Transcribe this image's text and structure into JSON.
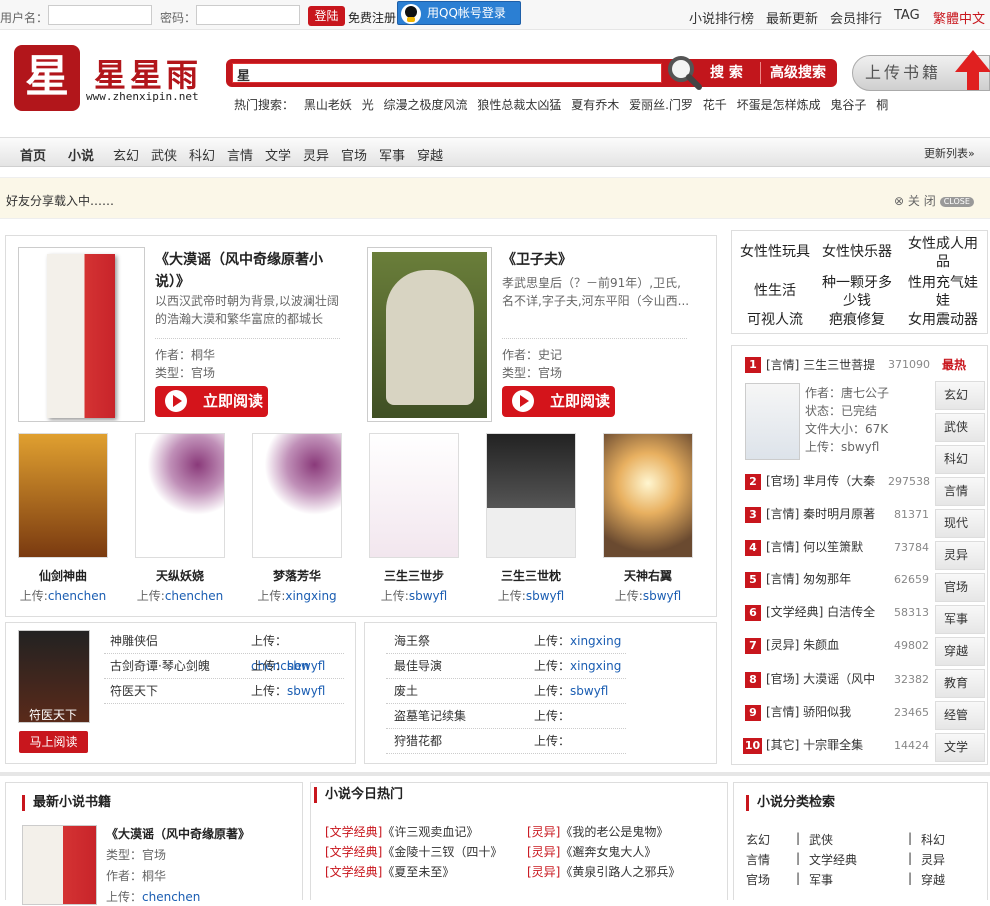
{
  "topbar": {
    "username_label": "用户名：",
    "password_label": "密码：",
    "login_btn": "登陆",
    "register": "免费注册",
    "qq_login": "用QQ帐号登录",
    "links": [
      "小说排行榜",
      "最新更新",
      "会员排行",
      "TAG"
    ],
    "lang": "繁體中文"
  },
  "logo": {
    "char": "星",
    "title": "星星雨",
    "url": "www.zhenxipin.net"
  },
  "search": {
    "value": "星",
    "search_btn": "搜 索",
    "advanced_btn": "高级搜索",
    "hot_label": "热门搜索：",
    "hot_terms": [
      "黑山老妖",
      "光",
      "综漫之极度风流",
      "狼性总裁太凶猛",
      "夏有乔木",
      "爱丽丝.门罗",
      "花千",
      "坏蛋是怎样炼成",
      "鬼谷子",
      "桐"
    ]
  },
  "upload": {
    "label": "上传书籍"
  },
  "nav": {
    "items": [
      "首页",
      "小说",
      "玄幻",
      "武侠",
      "科幻",
      "言情",
      "文学",
      "灵异",
      "官场",
      "军事",
      "穿越"
    ],
    "right": "更新列表»"
  },
  "share": {
    "text": "好友分享载入中……",
    "close": "关 闭",
    "close_badge": "CLOSE"
  },
  "featured": [
    {
      "title": "《大漠谣（风中奇缘原著小说）》",
      "desc": "以西汉武帝时朝为背景,以波澜壮阔的浩瀚大漠和繁华富庶的都城长",
      "author_label": "作者：",
      "author": "桐华",
      "type_label": "类型：",
      "type": "官场",
      "read": "立即阅读"
    },
    {
      "title": "《卫子夫》",
      "desc": "孝武思皇后（？－前91年）,卫氏,名不详,字子夫,河东平阳（今山西...",
      "author_label": "作者：",
      "author": "史记",
      "type_label": "类型：",
      "type": "官场",
      "read": "立即阅读"
    }
  ],
  "thumbs": [
    {
      "name": "仙剑神曲",
      "up_label": "上传:",
      "user": "chenchen"
    },
    {
      "name": "天纵妖娆",
      "up_label": "上传:",
      "user": "chenchen"
    },
    {
      "name": "梦落芳华",
      "up_label": "上传:",
      "user": "xingxing"
    },
    {
      "name": "三生三世步",
      "up_label": "上传:",
      "user": "sbwyfl"
    },
    {
      "name": "三生三世枕",
      "up_label": "上传:",
      "user": "sbwyfl"
    },
    {
      "name": "天神右翼",
      "up_label": "上传:",
      "user": "sbwyfl"
    }
  ],
  "list_left": {
    "cover_text": "符医天下",
    "read_btn": "马上阅读",
    "rows": [
      {
        "title": "神雕侠侣",
        "up_label": "上传：",
        "user": "chenchen"
      },
      {
        "title": "古剑奇谭·琴心剑魄",
        "up_label": "上传：",
        "user": "sbwyfl"
      },
      {
        "title": "符医天下",
        "up_label": "上传：",
        "user": "sbwyfl"
      }
    ]
  },
  "list_right": {
    "rows": [
      {
        "title": "海王祭",
        "up_label": "上传：",
        "user": "xingxing"
      },
      {
        "title": "最佳导演",
        "up_label": "上传：",
        "user": "xingxing"
      },
      {
        "title": "废土",
        "up_label": "上传：",
        "user": "sbwyfl"
      },
      {
        "title": "盗墓笔记续集",
        "up_label": "上传：",
        "user": ""
      },
      {
        "title": "狩猎花都",
        "up_label": "上传：",
        "user": ""
      }
    ]
  },
  "ads": [
    "女性性玩具",
    "女性快乐器",
    "女性成人用品",
    "性生活",
    "种一颗牙多少钱",
    "性用充气娃娃",
    "可视人流",
    "疤痕修复",
    "女用震动器"
  ],
  "rank": {
    "hot_label": "最热",
    "first": {
      "num": "1",
      "title": "[言情] 三生三世菩提",
      "val": "371090",
      "author": "作者：唐七公子",
      "status": "状态：已完结",
      "size": "文件大小：67K",
      "uploader": "上传：sbwyfl"
    },
    "items": [
      {
        "num": "2",
        "title": "[官场] 芈月传（大秦",
        "val": "297538"
      },
      {
        "num": "3",
        "title": "[言情] 秦时明月原著",
        "val": "81371"
      },
      {
        "num": "4",
        "title": "[言情] 何以笙箫默",
        "val": "73784"
      },
      {
        "num": "5",
        "title": "[言情] 匆匆那年",
        "val": "62659"
      },
      {
        "num": "6",
        "title": "[文学经典] 白洁传全",
        "val": "58313"
      },
      {
        "num": "7",
        "title": "[灵异] 朱颜血",
        "val": "49802"
      },
      {
        "num": "8",
        "title": "[官场] 大漠谣（风中",
        "val": "32382"
      },
      {
        "num": "9",
        "title": "[言情] 骄阳似我",
        "val": "23465"
      },
      {
        "num": "10",
        "title": "[其它] 十宗罪全集",
        "val": "14424"
      }
    ],
    "tabs": [
      "玄幻",
      "武侠",
      "科幻",
      "言情",
      "现代",
      "灵异",
      "官场",
      "军事",
      "穿越",
      "教育",
      "经管",
      "文学"
    ]
  },
  "latest": {
    "title": "最新小说书籍",
    "book": "《大漠谣（风中奇缘原著》",
    "type": "类型：官场",
    "author": "作者：桐华",
    "up_label": "上传：",
    "user": "chenchen"
  },
  "today": {
    "title": "小说今日热门",
    "left": [
      {
        "tag": "[文学经典]",
        "book": "《许三观卖血记》"
      },
      {
        "tag": "[文学经典]",
        "book": "《金陵十三钗（四十》"
      },
      {
        "tag": "[文学经典]",
        "book": "《夏至未至》"
      }
    ],
    "right": [
      {
        "tag": "[灵异]",
        "book": "《我的老公是鬼物》"
      },
      {
        "tag": "[灵异]",
        "book": "《邂奔女鬼大人》"
      },
      {
        "tag": "[灵异]",
        "book": "《黄泉引路人之邪兵》"
      }
    ]
  },
  "category": {
    "title": "小说分类检索",
    "rows": [
      [
        "玄幻",
        "武侠",
        "科幻"
      ],
      [
        "言情",
        "文学经典",
        "灵异"
      ],
      [
        "官场",
        "军事",
        "穿越"
      ]
    ]
  }
}
